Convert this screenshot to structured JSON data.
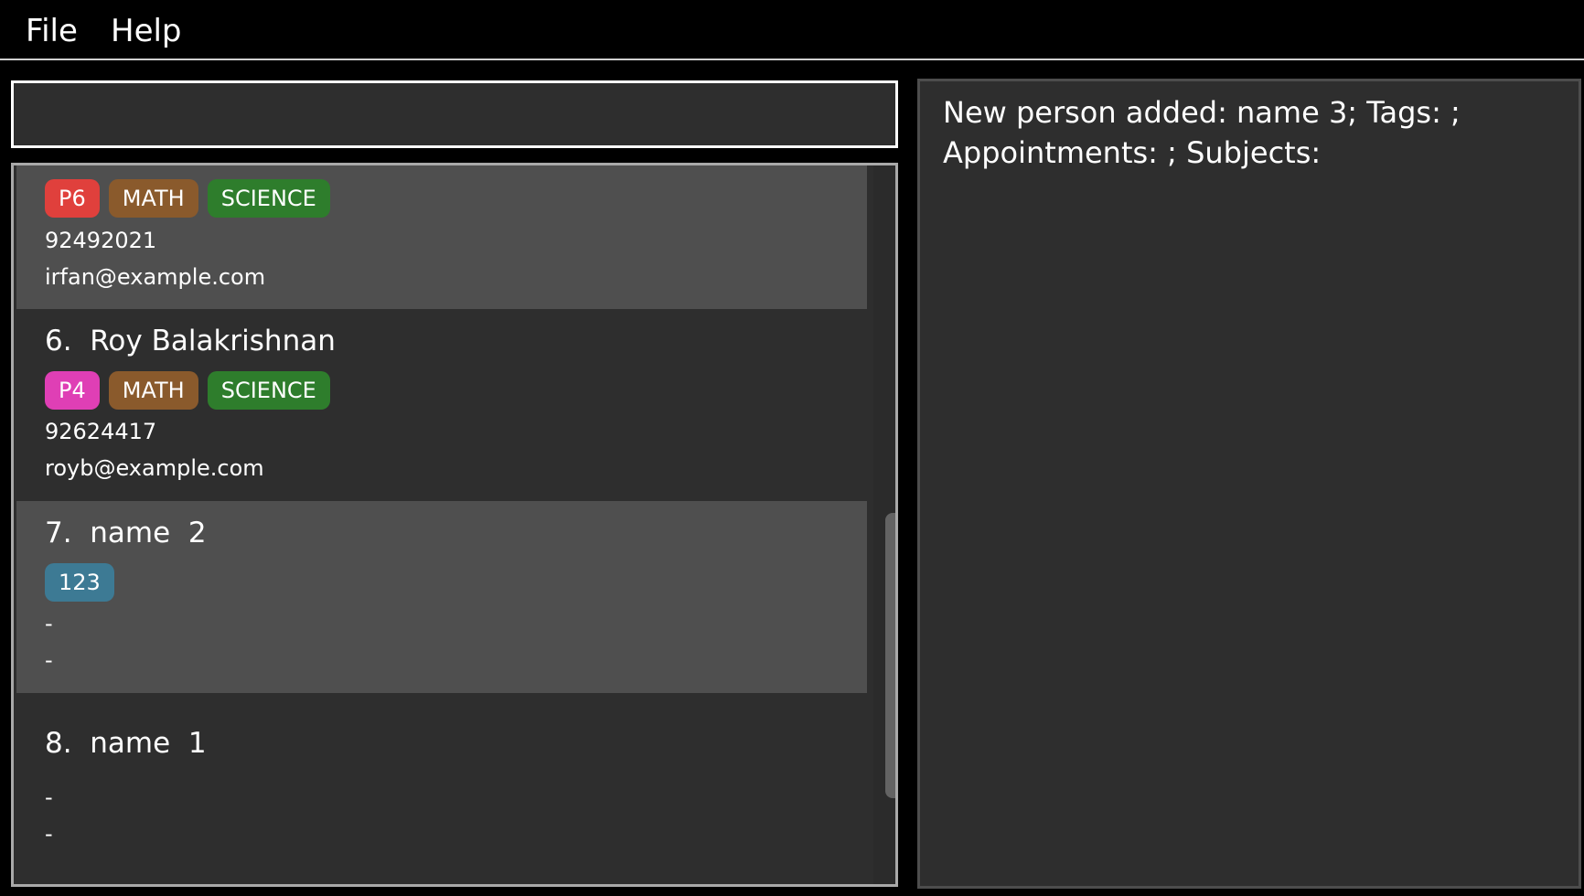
{
  "menu": {
    "file_label": "File",
    "help_label": "Help"
  },
  "command": {
    "value": "",
    "placeholder": ""
  },
  "person_list": {
    "cards": [
      {
        "tags": [
          "P6",
          "MATH",
          "SCIENCE"
        ],
        "phone": "92492021",
        "email": "irfan@example.com"
      },
      {
        "name": "6.  Roy Balakrishnan",
        "tags": [
          "P4",
          "MATH",
          "SCIENCE"
        ],
        "phone": "92624417",
        "email": "royb@example.com"
      },
      {
        "name": "7.  name  2",
        "tags": [
          "123"
        ],
        "phone": "-",
        "email": "-"
      },
      {
        "name": "8.  name  1",
        "tags": [],
        "phone": "-",
        "email": "-"
      }
    ]
  },
  "result": {
    "message": "New person added: name 3; Tags: ; Appointments: ; Subjects:"
  },
  "colors": {
    "tag_p6": "#e0403c",
    "tag_p4": "#df3fb5",
    "tag_math": "#8a5a2c",
    "tag_science": "#2e7d2c",
    "tag_123": "#3d7a94"
  }
}
